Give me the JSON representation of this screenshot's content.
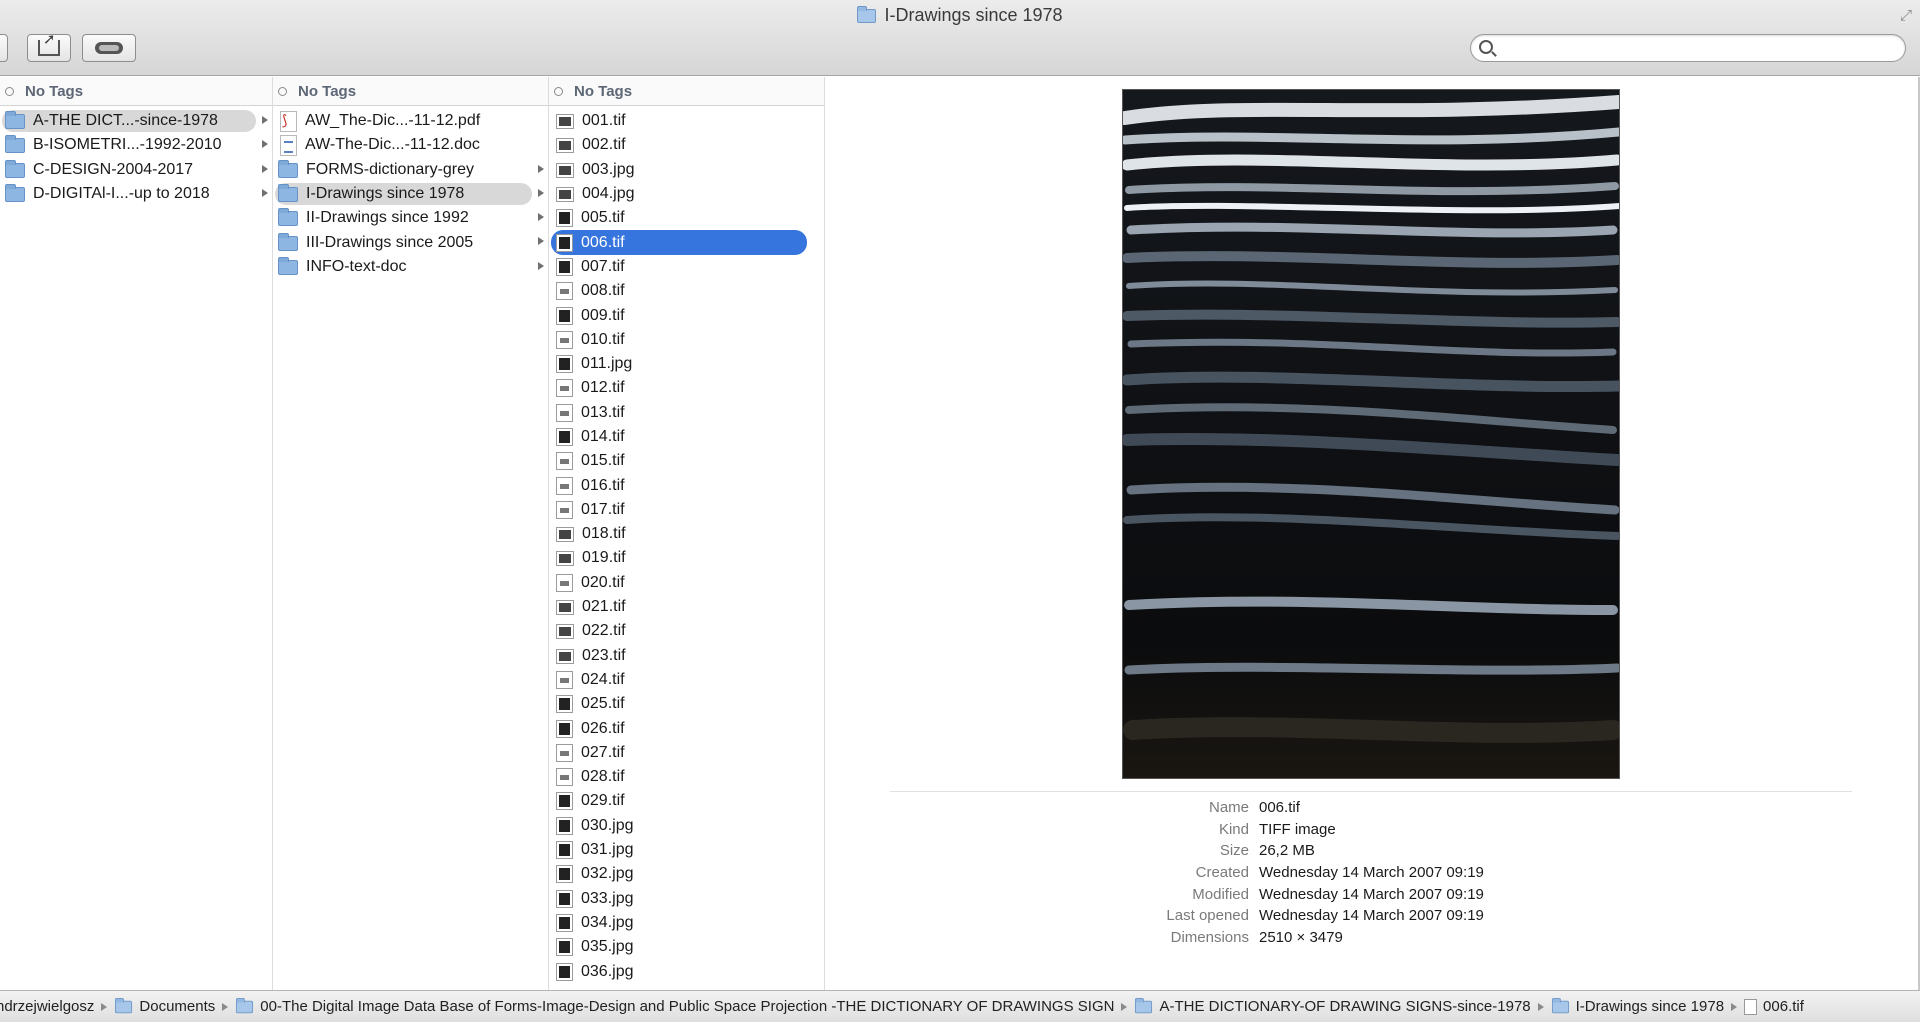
{
  "window": {
    "title": "I-Drawings since 1978"
  },
  "toolbar": {
    "search_value": "",
    "search_placeholder": ""
  },
  "columns": [
    {
      "header": "No Tags",
      "items": [
        {
          "label": "A-THE DICT...-since-1978",
          "icon": "folder-icon",
          "expandable": true,
          "state": "selected-path"
        },
        {
          "label": "B-ISOMETRI...-1992-2010",
          "icon": "folder-icon",
          "expandable": true
        },
        {
          "label": "C-DESIGN-2004-2017",
          "icon": "folder-icon",
          "expandable": true
        },
        {
          "label": "D-DIGITAl-I...-up to 2018",
          "icon": "folder-icon",
          "expandable": true
        }
      ]
    },
    {
      "header": "No Tags",
      "items": [
        {
          "label": "AW_The-Dic...-11-12.pdf",
          "icon": "pdf-icon"
        },
        {
          "label": "AW-The-Dic...-11-12.doc",
          "icon": "doc-icon"
        },
        {
          "label": "FORMS-dictionary-grey",
          "icon": "folder-icon",
          "expandable": true
        },
        {
          "label": "I-Drawings since 1978",
          "icon": "folder-icon",
          "expandable": true,
          "state": "selected-path"
        },
        {
          "label": "II-Drawings since 1992",
          "icon": "folder-icon",
          "expandable": true
        },
        {
          "label": "III-Drawings since 2005",
          "icon": "folder-icon",
          "expandable": true
        },
        {
          "label": "INFO-text-doc",
          "icon": "folder-icon",
          "expandable": true
        }
      ]
    },
    {
      "header": "No Tags",
      "items": [
        "001.tif",
        "002.tif",
        "003.jpg",
        "004.jpg",
        "005.tif",
        "006.tif",
        "007.tif",
        "008.tif",
        "009.tif",
        "010.tif",
        "011.jpg",
        "012.tif",
        "013.tif",
        "014.tif",
        "015.tif",
        "016.tif",
        "017.tif",
        "018.tif",
        "019.tif",
        "020.tif",
        "021.tif",
        "022.tif",
        "023.tif",
        "024.tif",
        "025.tif",
        "026.tif",
        "027.tif",
        "028.tif",
        "029.tif",
        "030.jpg",
        "031.jpg",
        "032.jpg",
        "033.jpg",
        "034.jpg",
        "035.jpg",
        "036.jpg"
      ],
      "selected": "006.tif"
    }
  ],
  "preview": {
    "info": [
      {
        "key": "Name",
        "value": "006.tif"
      },
      {
        "key": "Kind",
        "value": "TIFF image"
      },
      {
        "key": "Size",
        "value": "26,2 MB"
      },
      {
        "key": "Created",
        "value": "Wednesday 14 March 2007 09:19"
      },
      {
        "key": "Modified",
        "value": "Wednesday 14 March 2007 09:19"
      },
      {
        "key": "Last opened",
        "value": "Wednesday 14 March 2007 09:19"
      },
      {
        "key": "Dimensions",
        "value": "2510 × 3479"
      }
    ]
  },
  "pathbar": [
    {
      "label": "ndrzejwielgosz",
      "icon": "none"
    },
    {
      "label": "Documents",
      "icon": "folder"
    },
    {
      "label": "00-The Digital Image Data Base of Forms-Image-Design and Public Space Projection -THE DICTIONARY OF DRAWINGS SIGN",
      "icon": "folder"
    },
    {
      "label": "A-THE DICTIONARY-OF DRAWING SIGNS-since-1978",
      "icon": "folder"
    },
    {
      "label": "I-Drawings since 1978",
      "icon": "folder"
    },
    {
      "label": "006.tif",
      "icon": "file"
    }
  ]
}
